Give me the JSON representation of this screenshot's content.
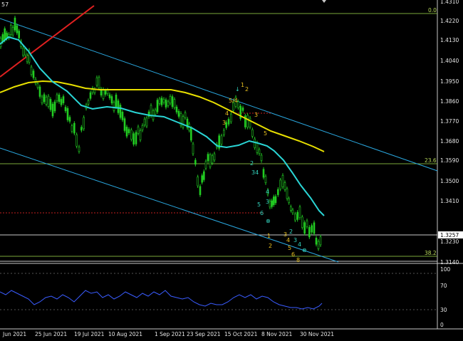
{
  "symbol_fragment": "57",
  "price_axis": {
    "labels": [
      "1.4310",
      "1.4220",
      "1.4130",
      "1.4040",
      "1.3950",
      "1.3860",
      "1.3770",
      "1.3680",
      "1.3590",
      "1.3500",
      "1.3410",
      "1.3230",
      "1.3140"
    ],
    "current_price": "1.3257",
    "min": 1.3125,
    "max": 1.431
  },
  "time_axis": {
    "labels": [
      "Jun 2021",
      "25 Jun 2021",
      "19 Jul 2021",
      "10 Aug 2021",
      "1 Sep 2021",
      "23 Sep 2021",
      "15 Oct 2021",
      "8 Nov 2021",
      "30 Nov 2021"
    ]
  },
  "fibonacci": {
    "level_0": "0.0",
    "level_236": "23.6",
    "level_382": "38.2"
  },
  "indicator_axis": {
    "labels": [
      "100",
      "70",
      "30",
      "0"
    ]
  },
  "colors": {
    "background": "#000000",
    "bull_candle": "#22cc22",
    "fast_ma": "#2ad5d5",
    "slow_ma": "#e8e000",
    "channel": "#2aa8e0",
    "trendline": "#e02020",
    "fib_line": "#7aa83a",
    "indicator": "#3a5cff",
    "wave_labels": "#e8c020",
    "wave_labels_alt": "#33d6c0"
  },
  "chart_data": {
    "type": "line",
    "title": "",
    "x": [
      "Jun 2021",
      "25 Jun 2021",
      "19 Jul 2021",
      "10 Aug 2021",
      "1 Sep 2021",
      "23 Sep 2021",
      "15 Oct 2021",
      "8 Nov 2021",
      "30 Nov 2021"
    ],
    "series": [
      {
        "name": "",
        "values": [
          1.413,
          1.39,
          1.388,
          1.376,
          1.382,
          1.356,
          1.379,
          1.337,
          1.3257
        ]
      }
    ],
    "ylim": [
      1.3125,
      1.431
    ],
    "grid": false
  }
}
